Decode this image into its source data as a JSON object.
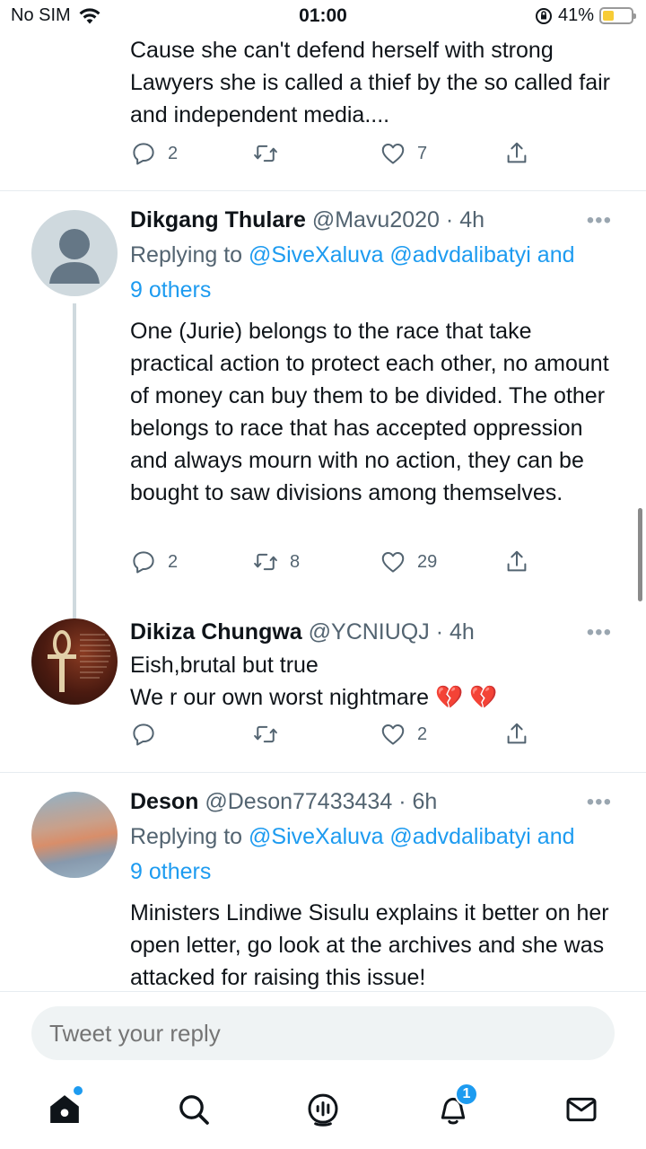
{
  "status_bar": {
    "carrier": "No SIM",
    "time": "01:00",
    "battery_percent": "41%",
    "battery_level": 0.41
  },
  "tweets": [
    {
      "body": "Cause she can't defend herself with strong Lawyers she is called a thief by the so called fair and independent media....",
      "replies": "2",
      "retweets": "",
      "likes": "7"
    },
    {
      "name": "Dikgang Thulare",
      "handle": "@Mavu2020",
      "time": "· 4h",
      "replying_prefix": "Replying to",
      "replying_users": "@SiveXaluva @advdalibatyi and",
      "replying_more": "9 others",
      "body": "One (Jurie) belongs to the race that take practical action to protect each other, no amount of money can buy them to be divided. The other belongs to race that has accepted oppression and always mourn with no action, they can be bought to saw divisions among themselves.",
      "replies": "2",
      "retweets": "8",
      "likes": "29"
    },
    {
      "name": "Dikiza Chungwa",
      "handle": "@YCNIUQJ",
      "time": "· 4h",
      "line1": "Eish,brutal but true",
      "line2": "We r our own worst nightmare 💔 💔",
      "replies": "",
      "retweets": "",
      "likes": "2"
    },
    {
      "name": "Deson",
      "handle": "@Deson77433434",
      "time": "· 6h",
      "replying_prefix": "Replying to",
      "replying_users": "@SiveXaluva @advdalibatyi and",
      "replying_more": "9 others",
      "body": "Ministers Lindiwe Sisulu explains it better on her open letter, go look at the archives and she was attacked for raising this issue!"
    }
  ],
  "more_glyph": "•••",
  "reply_placeholder": "Tweet your reply",
  "nav": {
    "notifications_badge": "1"
  },
  "colors": {
    "accent": "#1d9bf0",
    "secondary_text": "#536471",
    "heart_broken": "#e0245e"
  },
  "icons": [
    "reply-icon",
    "retweet-icon",
    "like-icon",
    "share-icon",
    "home-icon",
    "search-icon",
    "spaces-icon",
    "notifications-icon",
    "messages-icon",
    "more-icon"
  ]
}
